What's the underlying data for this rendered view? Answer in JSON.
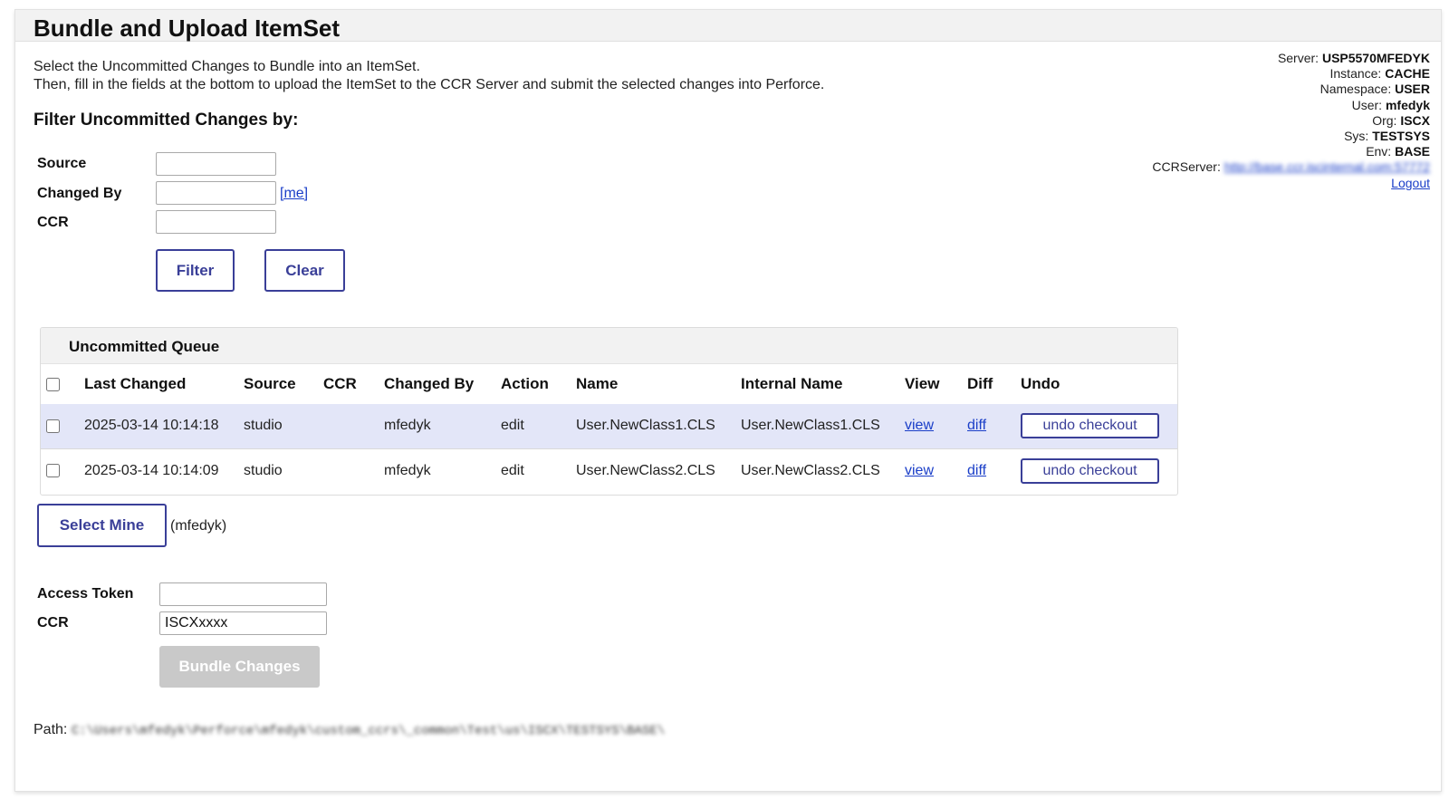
{
  "page": {
    "title": "Bundle and Upload ItemSet",
    "intro_line1": "Select the Uncommitted Changes to Bundle into an ItemSet.",
    "intro_line2": "Then, fill in the fields at the bottom to upload the ItemSet to the CCR Server and submit the selected changes into Perforce."
  },
  "filter": {
    "heading": "Filter Uncommitted Changes by:",
    "source_label": "Source",
    "source_value": "",
    "changed_by_label": "Changed By",
    "changed_by_value": "",
    "me_link": "[me]",
    "ccr_label": "CCR",
    "ccr_value": "",
    "filter_button": "Filter",
    "clear_button": "Clear"
  },
  "server_info": {
    "server_label": "Server:",
    "server_value": "USP5570MFEDYK",
    "instance_label": "Instance:",
    "instance_value": "CACHE",
    "namespace_label": "Namespace:",
    "namespace_value": "USER",
    "user_label": "User:",
    "user_value": "mfedyk",
    "org_label": "Org:",
    "org_value": "ISCX",
    "sys_label": "Sys:",
    "sys_value": "TESTSYS",
    "env_label": "Env:",
    "env_value": "BASE",
    "ccrserver_label": "CCRServer:",
    "ccrserver_link": "http://base.ccr.iscinternal.com:57772",
    "logout_link": "Logout"
  },
  "queue": {
    "title": "Uncommitted Queue",
    "columns": [
      "Last Changed",
      "Source",
      "CCR",
      "Changed By",
      "Action",
      "Name",
      "Internal Name",
      "View",
      "Diff",
      "Undo"
    ],
    "rows": [
      {
        "last_changed": "2025-03-14 10:14:18",
        "source": "studio",
        "ccr": "",
        "changed_by": "mfedyk",
        "action": "edit",
        "name": "User.NewClass1.CLS",
        "internal_name": "User.NewClass1.CLS",
        "view": "view",
        "diff": "diff",
        "undo": "undo checkout"
      },
      {
        "last_changed": "2025-03-14 10:14:09",
        "source": "studio",
        "ccr": "",
        "changed_by": "mfedyk",
        "action": "edit",
        "name": "User.NewClass2.CLS",
        "internal_name": "User.NewClass2.CLS",
        "view": "view",
        "diff": "diff",
        "undo": "undo checkout"
      }
    ],
    "select_mine_button": "Select Mine",
    "select_mine_note": "(mfedyk)"
  },
  "bundle": {
    "access_token_label": "Access Token",
    "access_token_value": "",
    "ccr_label": "CCR",
    "ccr_value": "ISCXxxxx",
    "bundle_button": "Bundle Changes"
  },
  "footer": {
    "path_label": "Path:",
    "path_value": "C:\\Users\\mfedyk\\Perforce\\mfedyk\\custom_ccrs\\_common\\Test\\us\\ISCX\\TESTSYS\\BASE\\"
  },
  "colors": {
    "accent": "#3a3f98",
    "link": "#1a3ec8",
    "selected_row": "#e3e6f8",
    "disabled_button": "#c9c9c9"
  }
}
